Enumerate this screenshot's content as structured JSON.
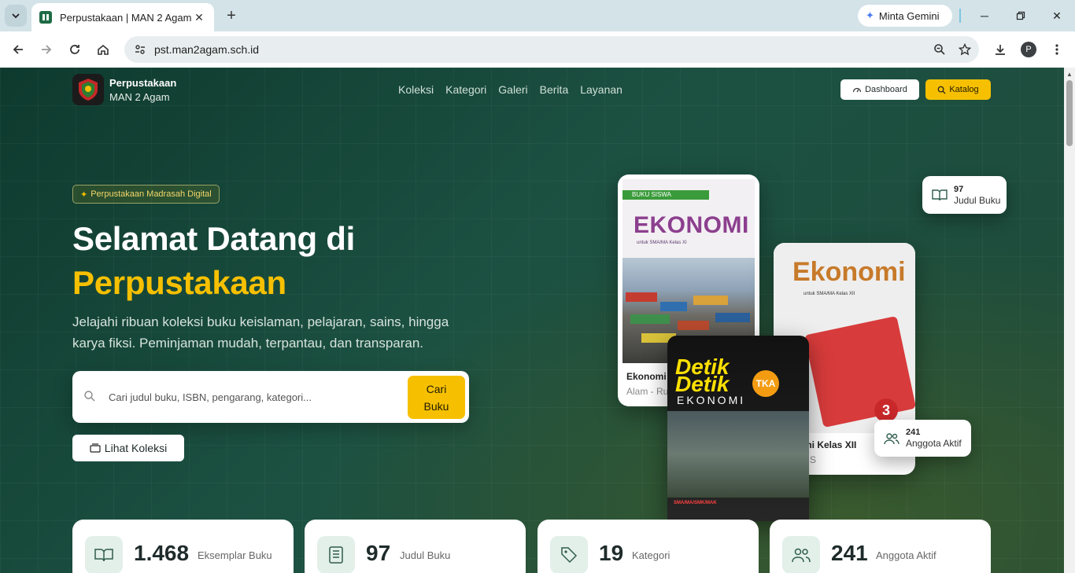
{
  "browser": {
    "tab_title": "Perpustakaan | MAN 2 Agam",
    "gemini_label": "Minta Gemini",
    "url": "pst.man2agam.sch.id",
    "profile_initial": "P"
  },
  "header": {
    "brand_title": "Perpustakaan",
    "brand_subtitle": "MAN 2 Agam",
    "menu": [
      "Koleksi",
      "Kategori",
      "Galeri",
      "Berita",
      "Layanan"
    ],
    "dashboard_label": "Dashboard",
    "katalog_label": "Katalog"
  },
  "hero": {
    "pill": "Perpustakaan Madrasah Digital",
    "title_line1": "Selamat Datang di",
    "title_line2": "Perpustakaan",
    "lead": "Jelajahi ribuan koleksi buku keislaman, pelajaran, sains, hingga karya fiksi. Peminjaman mudah, terpantau, dan transparan.",
    "search_placeholder": "Cari judul buku, ISBN, pengarang, kategori...",
    "search_button": "Cari Buku",
    "lihat_koleksi": "Lihat Koleksi"
  },
  "books": [
    {
      "card_title": "Ekonomi",
      "card_sub": "Alam - Ru",
      "cover_series": "BUKU SISWA",
      "cover_title": "EKONOMI",
      "cover_sub": "untuk SMA/MA Kelas XI"
    },
    {
      "card_title": "mi Kelas XII",
      "card_sub": "S",
      "cover_title": "Ekonomi",
      "cover_sub": "untuk SMA/MA Kelas XII",
      "cover_number": "3"
    },
    {
      "cover_line1": "Detik",
      "cover_line2": "Detik",
      "cover_badge": "TKA",
      "cover_sub": "EKONOMI",
      "cover_foot": "SMA/MA/SMK/MAK"
    }
  ],
  "badges": {
    "judul": {
      "value": "97",
      "label": "Judul Buku"
    },
    "anggota": {
      "value": "241",
      "label": "Anggota Aktif"
    }
  },
  "stats": [
    {
      "value": "1.468",
      "label": "Eksemplar Buku",
      "icon": "book-open-icon"
    },
    {
      "value": "97",
      "label": "Judul Buku",
      "icon": "list-book-icon"
    },
    {
      "value": "19",
      "label": "Kategori",
      "icon": "tag-icon"
    },
    {
      "value": "241",
      "label": "Anggota Aktif",
      "icon": "users-icon"
    }
  ],
  "colors": {
    "accent": "#f6c000",
    "hero_bg": "#1c5142"
  }
}
